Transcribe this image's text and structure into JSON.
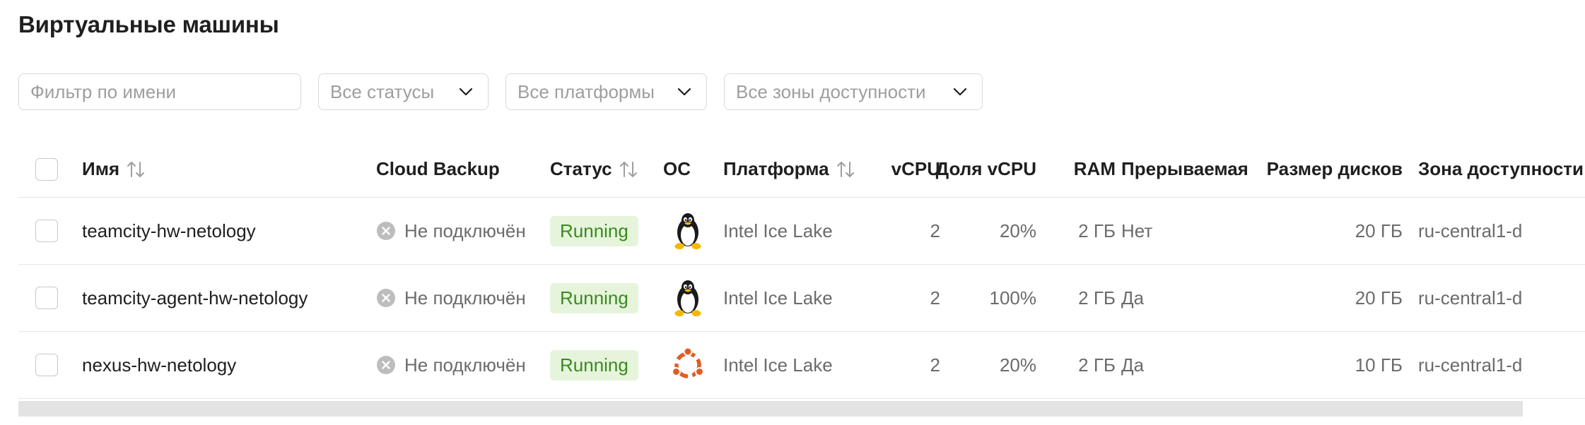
{
  "page": {
    "title": "Виртуальные машины"
  },
  "filters": {
    "name_placeholder": "Фильтр по имени",
    "status_value": "Все статусы",
    "platform_value": "Все платформы",
    "zone_value": "Все зоны доступности"
  },
  "table": {
    "columns": {
      "name": "Имя",
      "backup": "Cloud Backup",
      "status": "Статус",
      "os": "ОС",
      "platform": "Платформа",
      "vcpu": "vCPU",
      "vcpu_share": "Доля vCPU",
      "ram": "RAM",
      "preemptible": "Прерываемая",
      "disk_size": "Размер дисков",
      "zone": "Зона доступности"
    },
    "rows": [
      {
        "name": "teamcity-hw-netology",
        "backup": "Не подключён",
        "status": "Running",
        "os_icon": "linux-tux-icon",
        "platform": "Intel Ice Lake",
        "vcpu": "2",
        "vcpu_share": "20%",
        "ram": "2 ГБ",
        "preemptible": "Нет",
        "disk_size": "20 ГБ",
        "zone": "ru-central1-d"
      },
      {
        "name": "teamcity-agent-hw-netology",
        "backup": "Не подключён",
        "status": "Running",
        "os_icon": "linux-tux-icon",
        "platform": "Intel Ice Lake",
        "vcpu": "2",
        "vcpu_share": "100%",
        "ram": "2 ГБ",
        "preemptible": "Да",
        "disk_size": "20 ГБ",
        "zone": "ru-central1-d"
      },
      {
        "name": "nexus-hw-netology",
        "backup": "Не подключён",
        "status": "Running",
        "os_icon": "ubuntu-icon",
        "platform": "Intel Ice Lake",
        "vcpu": "2",
        "vcpu_share": "20%",
        "ram": "2 ГБ",
        "preemptible": "Да",
        "disk_size": "10 ГБ",
        "zone": "ru-central1-d"
      }
    ]
  },
  "colors": {
    "status_running_bg": "#e6f4dc",
    "status_running_text": "#3a8a1e",
    "ubuntu_orange": "#e05d21"
  }
}
